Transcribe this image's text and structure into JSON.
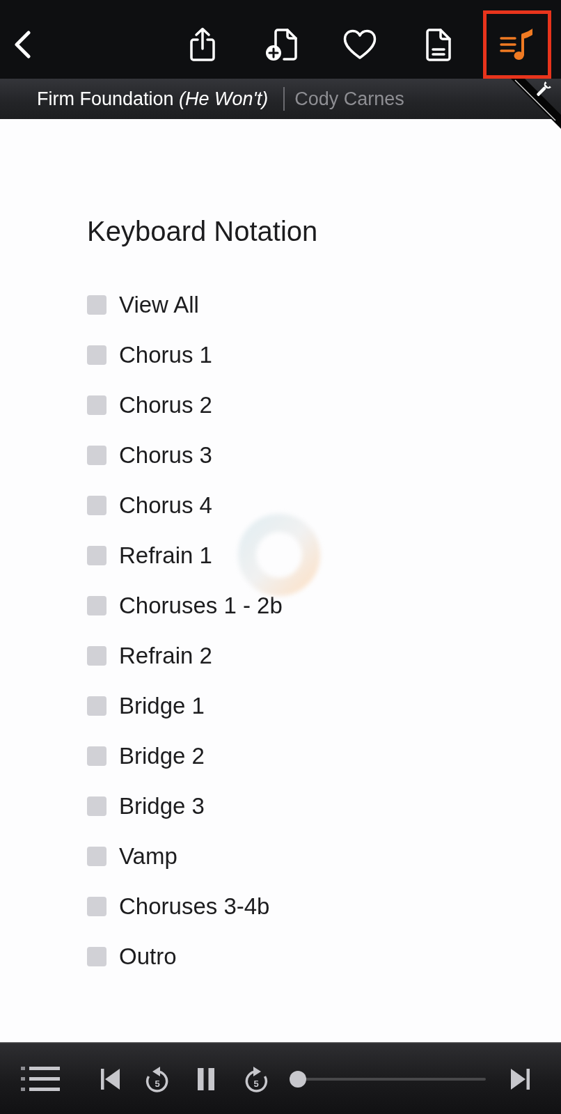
{
  "toolbar": {
    "buttons": [
      {
        "kind": "share",
        "selected": false,
        "highlighted": false
      },
      {
        "kind": "add-document",
        "selected": false,
        "highlighted": false
      },
      {
        "kind": "favorite",
        "selected": false,
        "highlighted": false
      },
      {
        "kind": "document",
        "selected": false,
        "highlighted": false
      },
      {
        "kind": "notation",
        "selected": true,
        "highlighted": true
      }
    ]
  },
  "song": {
    "title": "Firm Foundation *(He Won't)*",
    "artist": "Cody Carnes"
  },
  "panel": {
    "heading": "Keyboard Notation",
    "loading": true,
    "options": [
      {
        "label": "View All",
        "checked": false
      },
      {
        "label": "Chorus 1",
        "checked": false
      },
      {
        "label": "Chorus 2",
        "checked": false
      },
      {
        "label": "Chorus 3",
        "checked": false
      },
      {
        "label": "Chorus 4",
        "checked": false
      },
      {
        "label": "Refrain 1",
        "checked": false
      },
      {
        "label": "Choruses 1 - 2b",
        "checked": false
      },
      {
        "label": "Refrain 2",
        "checked": false
      },
      {
        "label": "Bridge 1",
        "checked": false
      },
      {
        "label": "Bridge 2",
        "checked": false
      },
      {
        "label": "Bridge 3",
        "checked": false
      },
      {
        "label": "Vamp",
        "checked": false
      },
      {
        "label": "Choruses 3-4b",
        "checked": false
      },
      {
        "label": "Outro",
        "checked": false
      }
    ]
  },
  "player": {
    "playing": true,
    "rewind_label": "5",
    "forward_label": "5",
    "level": 0
  }
}
